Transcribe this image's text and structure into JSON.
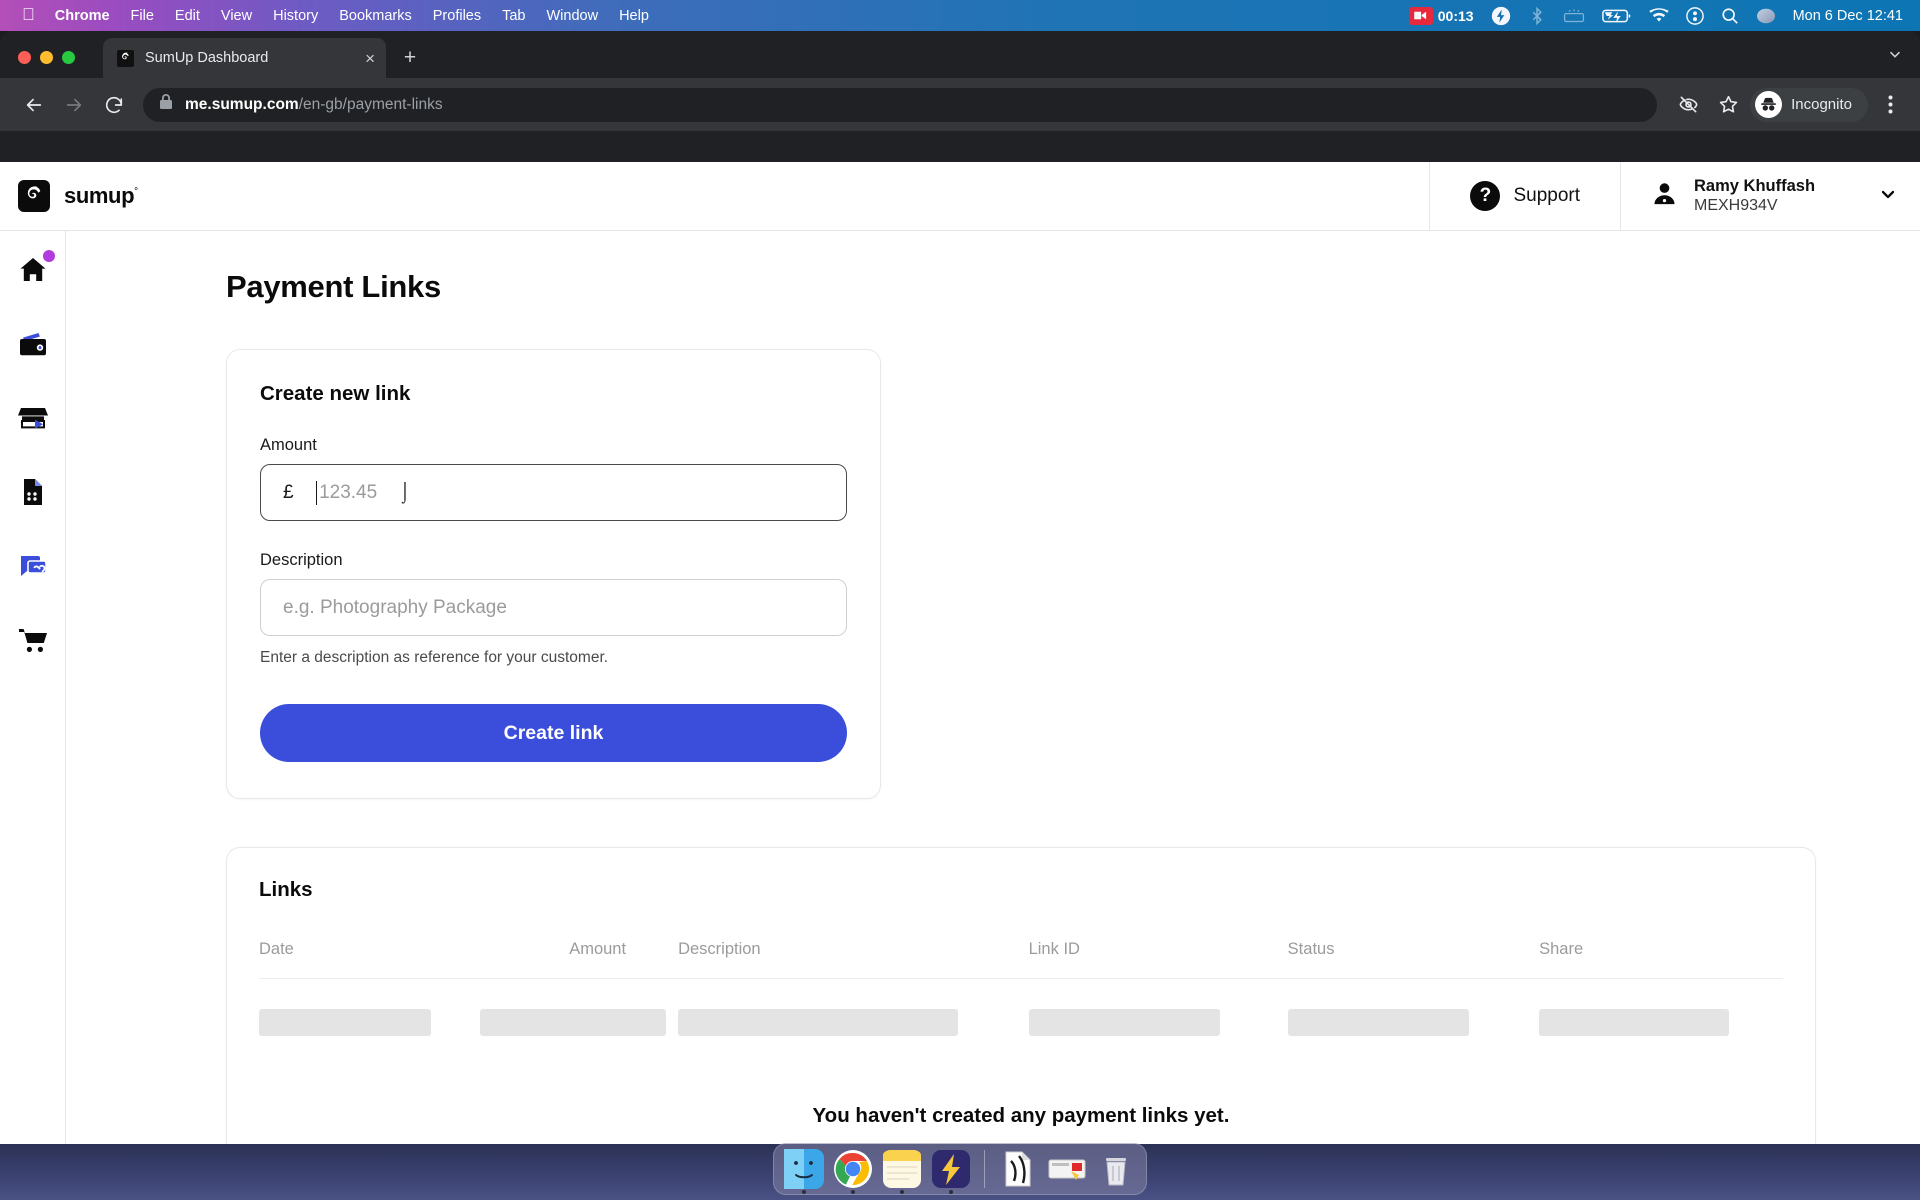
{
  "os": {
    "apple_menu": "apple-logo",
    "menus": [
      "Chrome",
      "File",
      "Edit",
      "View",
      "History",
      "Bookmarks",
      "Profiles",
      "Tab",
      "Window",
      "Help"
    ],
    "recording_time": "00:13",
    "status_icons": [
      "screen-record-icon",
      "flash-circle-icon",
      "bluetooth-off-icon",
      "keyboard-brightness-icon",
      "battery-charging-icon",
      "wifi-icon",
      "control-center-icon",
      "search-icon",
      "siri-icon"
    ],
    "clock": "Mon 6 Dec 12:41"
  },
  "browser": {
    "tab": {
      "title": "SumUp Dashboard",
      "favicon": "sumup-favicon",
      "close": "×"
    },
    "new_tab": "+",
    "tabstrip_chevron": "chevron-down-icon",
    "nav": {
      "back": "back-arrow-icon",
      "forward": "forward-arrow-icon",
      "reload": "reload-icon"
    },
    "omnibox": {
      "lock": "lock-icon",
      "url_host": "me.sumup.com",
      "url_path": "/en-gb/payment-links"
    },
    "actions": {
      "tracking": "eye-off-icon",
      "bookmark": "star-icon",
      "profile_label": "Incognito",
      "profile_icon": "incognito-icon",
      "menu": "kebab-menu-icon"
    }
  },
  "app": {
    "brand": {
      "word": "sumup",
      "reg": "°",
      "mark": "sumup-logo-mark"
    },
    "support_label": "Support",
    "support_icon": "question-circle-icon",
    "account": {
      "name": "Ramy Khuffash",
      "merchant_id": "MEXH934V",
      "avatar_icon": "person-icon",
      "chevron": "chevron-down-icon"
    },
    "sidebar": [
      {
        "name": "home",
        "icon": "home-icon",
        "badge": true,
        "active": false
      },
      {
        "name": "wallet",
        "icon": "wallet-icon",
        "badge": false,
        "active": false
      },
      {
        "name": "shop",
        "icon": "store-icon",
        "badge": false,
        "active": false
      },
      {
        "name": "invoices",
        "icon": "document-icon",
        "badge": false,
        "active": false
      },
      {
        "name": "payment-links",
        "icon": "payment-link-icon",
        "badge": false,
        "active": true
      },
      {
        "name": "orders",
        "icon": "shopping-cart-icon",
        "badge": false,
        "active": false
      }
    ],
    "colors": {
      "accent_blue": "#3b4ddb",
      "badge_purple": "#b13bdc",
      "link_icon_blue": "#3b4ddb",
      "text_primary": "#0b0b0b",
      "text_muted": "#9b9b9b"
    },
    "page_title": "Payment Links",
    "create_card": {
      "heading": "Create new link",
      "amount_label": "Amount",
      "currency_symbol": "£",
      "amount_value": "",
      "amount_placeholder": "123.45",
      "description_label": "Description",
      "description_value": "",
      "description_placeholder": "e.g. Photography Package",
      "helper_text": "Enter a description as reference for your customer.",
      "submit_label": "Create link"
    },
    "links_card": {
      "heading": "Links",
      "columns": [
        "Date",
        "Amount",
        "Description",
        "Link ID",
        "Status",
        "Share"
      ],
      "rows": [],
      "skeleton_row": true,
      "empty_message": "You haven't created any payment links yet."
    }
  },
  "dock": {
    "apps": [
      "finder-icon",
      "chrome-icon",
      "notes-icon",
      "flash-app-icon"
    ],
    "others": [
      "document-file-icon",
      "screenshot-icon",
      "trash-icon"
    ]
  }
}
